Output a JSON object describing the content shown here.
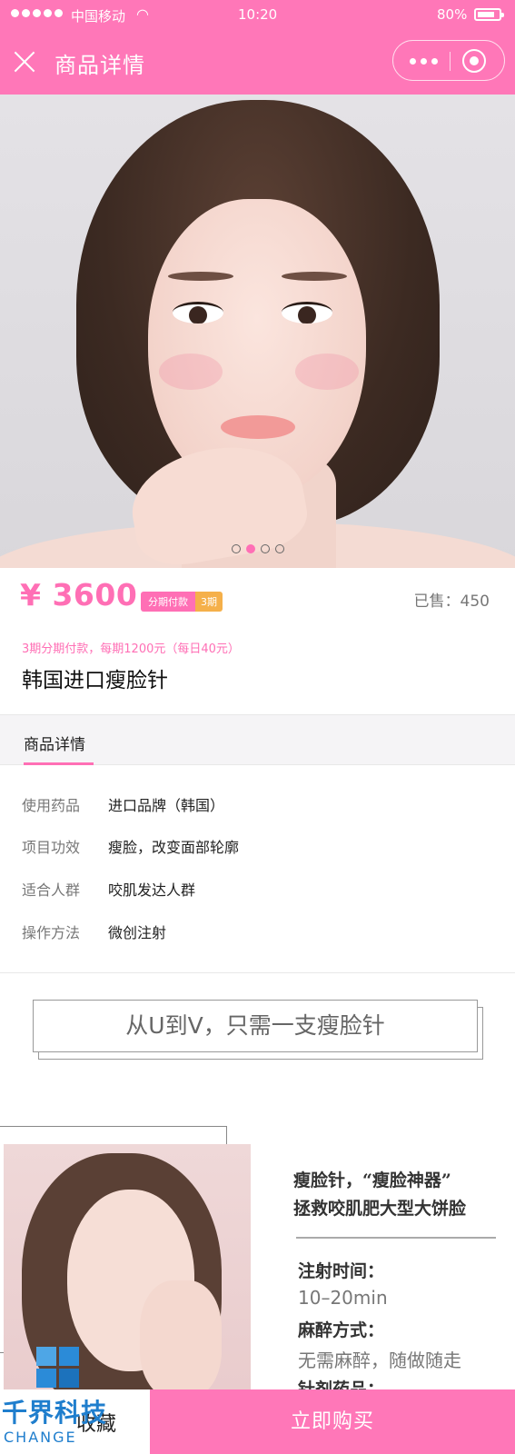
{
  "status": {
    "carrier": "中国移动",
    "time": "10:20",
    "battery": "80%",
    "battery_level": 0.8
  },
  "nav": {
    "title": "商品详情"
  },
  "carousel": {
    "slides": 4,
    "active_index": 1
  },
  "product": {
    "price": "¥ 3600",
    "badge_label": "分期付款",
    "badge_periods": "3期",
    "sold": "已售：450",
    "installment_text": "3期分期付款，每期1200元（每日40元）",
    "name": "韩国进口瘦脸针"
  },
  "tabs": [
    {
      "label": "商品详情",
      "active": true
    }
  ],
  "specs": [
    {
      "key": "使用药品",
      "value": "进口品牌（韩国）"
    },
    {
      "key": "项目功效",
      "value": "瘦脸，改变面部轮廓"
    },
    {
      "key": "适合人群",
      "value": "咬肌发达人群"
    },
    {
      "key": "操作方法",
      "value": "微创注射"
    }
  ],
  "slogan": "从U到V，只需一支瘦脸针",
  "promo": {
    "headline_1": "瘦脸针，“瘦脸神器”",
    "headline_2": "拯救咬肌肥大型大饼脸",
    "items": [
      {
        "key": "注射时间：",
        "value": "10–20min"
      },
      {
        "key": "麻醉方式：",
        "value": "无需麻醉，随做随走"
      },
      {
        "key": "针剂药品：",
        "value": ""
      }
    ]
  },
  "bottom": {
    "favorite_label": "收藏",
    "buy_label": "立即购买"
  },
  "watermark": {
    "cn": "千界科技",
    "en": "CHANGE"
  },
  "colors": {
    "brand_pink": "#ff77b8",
    "price_pink": "#ff6fb5",
    "badge_orange": "#f5b04a"
  }
}
